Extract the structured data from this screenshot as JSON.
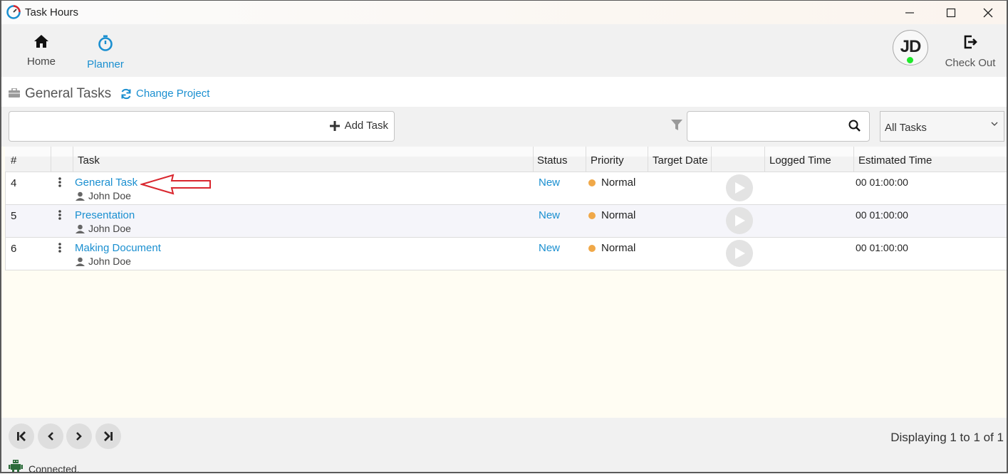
{
  "app": {
    "title": "Task Hours"
  },
  "toolbar": {
    "home_label": "Home",
    "planner_label": "Planner",
    "avatar_initials": "JD",
    "checkout_label": "Check Out"
  },
  "project": {
    "title": "General Tasks",
    "change_label": "Change Project"
  },
  "actions": {
    "add_task_label": "Add Task",
    "add_task_value": "",
    "search_value": "",
    "filter_selected": "All Tasks"
  },
  "grid": {
    "columns": [
      "#",
      "Task",
      "Status",
      "Priority",
      "Target Date",
      "Logged Time",
      "Estimated Time"
    ],
    "rows": [
      {
        "num": "4",
        "task": "General Task",
        "assignee": "John Doe",
        "status": "New",
        "priority": "Normal",
        "target_date": "",
        "logged": "",
        "estimated": "00 01:00:00"
      },
      {
        "num": "5",
        "task": "Presentation",
        "assignee": "John Doe",
        "status": "New",
        "priority": "Normal",
        "target_date": "",
        "logged": "",
        "estimated": "00 01:00:00"
      },
      {
        "num": "6",
        "task": "Making Document",
        "assignee": "John Doe",
        "status": "New",
        "priority": "Normal",
        "target_date": "",
        "logged": "",
        "estimated": "00 01:00:00"
      }
    ]
  },
  "pagination": {
    "info": "Displaying 1 to 1 of 1"
  },
  "status": {
    "connection": "Connected."
  },
  "colors": {
    "accent": "#1a8fd0",
    "priority_normal": "#f0a848",
    "online": "#1ee82a",
    "annotation_arrow": "#d9262e"
  },
  "icons": [
    "app-logo-icon",
    "minimize-icon",
    "maximize-icon",
    "close-icon",
    "home-icon",
    "stopwatch-icon",
    "check-out-icon",
    "briefcase-icon",
    "refresh-icon",
    "plus-icon",
    "filter-icon",
    "search-icon",
    "chevron-down-icon",
    "kebab-menu-icon",
    "user-icon",
    "play-icon",
    "first-page-icon",
    "prev-page-icon",
    "next-page-icon",
    "last-page-icon",
    "robot-icon"
  ]
}
